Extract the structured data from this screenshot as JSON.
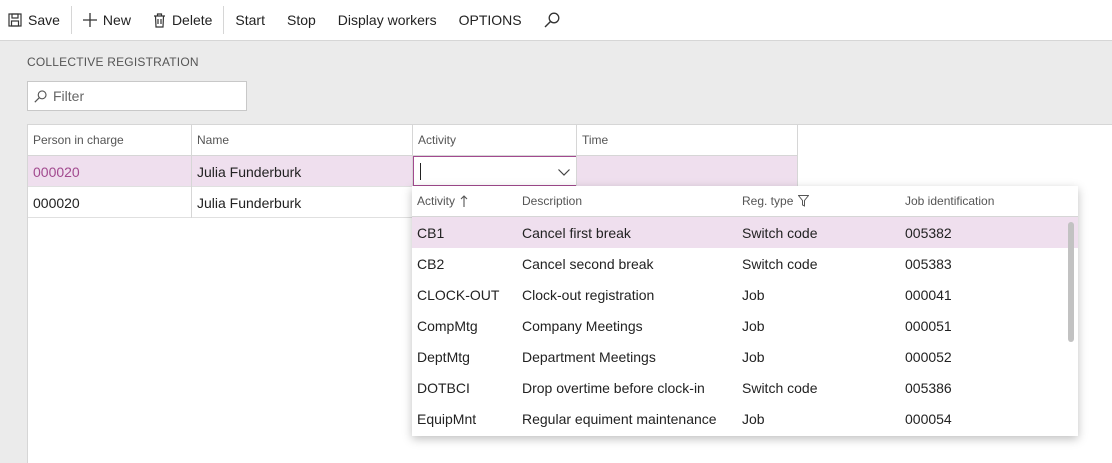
{
  "toolbar": {
    "save_label": "Save",
    "new_label": "New",
    "delete_label": "Delete",
    "start_label": "Start",
    "stop_label": "Stop",
    "display_workers_label": "Display workers",
    "options_label": "OPTIONS"
  },
  "section": {
    "title": "COLLECTIVE REGISTRATION"
  },
  "filter": {
    "placeholder": "Filter"
  },
  "grid": {
    "headers": [
      "Person in charge",
      "Name",
      "Activity",
      "Time"
    ],
    "rows": [
      {
        "person": "000020",
        "name": "Julia Funderburk",
        "activity": "",
        "time": ""
      },
      {
        "person": "000020",
        "name": "Julia Funderburk",
        "activity": "",
        "time": ""
      }
    ]
  },
  "dropdown": {
    "headers": [
      "Activity",
      "Description",
      "Reg. type",
      "Job identification"
    ],
    "rows": [
      {
        "activity": "CB1",
        "description": "Cancel first break",
        "reg_type": "Switch code",
        "job_id": "005382"
      },
      {
        "activity": "CB2",
        "description": "Cancel second break",
        "reg_type": "Switch code",
        "job_id": "005383"
      },
      {
        "activity": "CLOCK-OUT",
        "description": "Clock-out registration",
        "reg_type": "Job",
        "job_id": "000041"
      },
      {
        "activity": "CompMtg",
        "description": "Company Meetings",
        "reg_type": "Job",
        "job_id": "000051"
      },
      {
        "activity": "DeptMtg",
        "description": "Department Meetings",
        "reg_type": "Job",
        "job_id": "000052"
      },
      {
        "activity": "DOTBCI",
        "description": "Drop overtime before clock-in",
        "reg_type": "Switch code",
        "job_id": "005386"
      },
      {
        "activity": "EquipMnt",
        "description": "Regular equiment maintenance",
        "reg_type": "Job",
        "job_id": "000054"
      }
    ]
  },
  "colors": {
    "accent": "#a24a8f",
    "selected_row": "#efdfee",
    "page_bg": "#ebebeb"
  }
}
